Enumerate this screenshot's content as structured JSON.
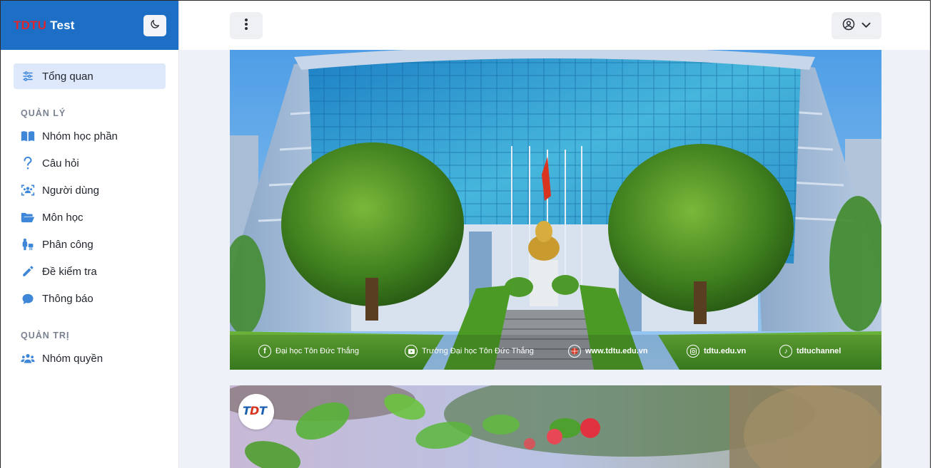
{
  "brand": {
    "part1": "TDTU",
    "part2": "Test"
  },
  "sidebar": {
    "overview": {
      "label": "Tổng quan"
    },
    "sections": [
      {
        "title": "QUẢN LÝ"
      },
      {
        "title": "QUẢN TRỊ"
      }
    ],
    "items": [
      {
        "label": "Nhóm học phần",
        "icon": "book-open-icon"
      },
      {
        "label": "Câu hỏi",
        "icon": "question-icon"
      },
      {
        "label": "Người dùng",
        "icon": "users-scan-icon"
      },
      {
        "label": "Môn học",
        "icon": "folder-open-icon"
      },
      {
        "label": "Phân công",
        "icon": "assign-icon"
      },
      {
        "label": "Đề kiểm tra",
        "icon": "pencil-icon"
      },
      {
        "label": "Thông báo",
        "icon": "chat-icon"
      },
      {
        "label": "Nhóm quyền",
        "icon": "user-group-icon"
      }
    ]
  },
  "banner": {
    "footer_links": [
      {
        "label": "Đại học Tôn Đức Thắng",
        "icon": "facebook-icon"
      },
      {
        "label": "Trường Đại học Tôn Đức Thắng",
        "icon": "youtube-icon"
      },
      {
        "label": "www.tdtu.edu.vn",
        "icon": "globe-icon"
      },
      {
        "label": "tdtu.edu.vn",
        "icon": "instagram-icon"
      },
      {
        "label": "tdtuchannel",
        "icon": "tiktok-icon"
      }
    ]
  },
  "colors": {
    "accent": "#1c6fc4",
    "brand_red": "#e0242c",
    "icon_blue": "#3d86d8",
    "active_bg": "#dde9fb"
  }
}
